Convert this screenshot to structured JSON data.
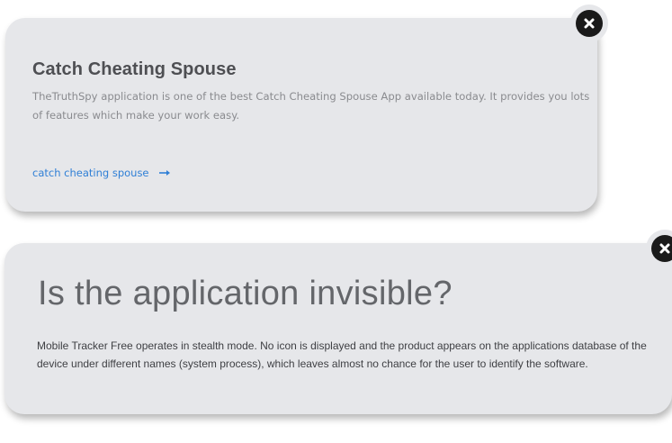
{
  "cards": [
    {
      "title": "Catch Cheating Spouse",
      "description": "TheTruthSpy application is one of the best Catch Cheating Spouse App available today. It provides you lots of features which make your work easy.",
      "link_label": "catch cheating spouse",
      "link_icon": "arrow-right-icon",
      "close_icon": "close-icon"
    },
    {
      "title": "Is the application invisible?",
      "description": "Mobile Tracker Free operates in stealth mode. No icon is displayed and the product appears on the applications database of the device under different names (system process), which leaves almost no chance for the user to identify the software.",
      "close_icon": "close-icon"
    }
  ],
  "colors": {
    "card_background": "#e6e7ea",
    "link": "#2f7fd6",
    "close_disc": "#1a1a1a"
  }
}
